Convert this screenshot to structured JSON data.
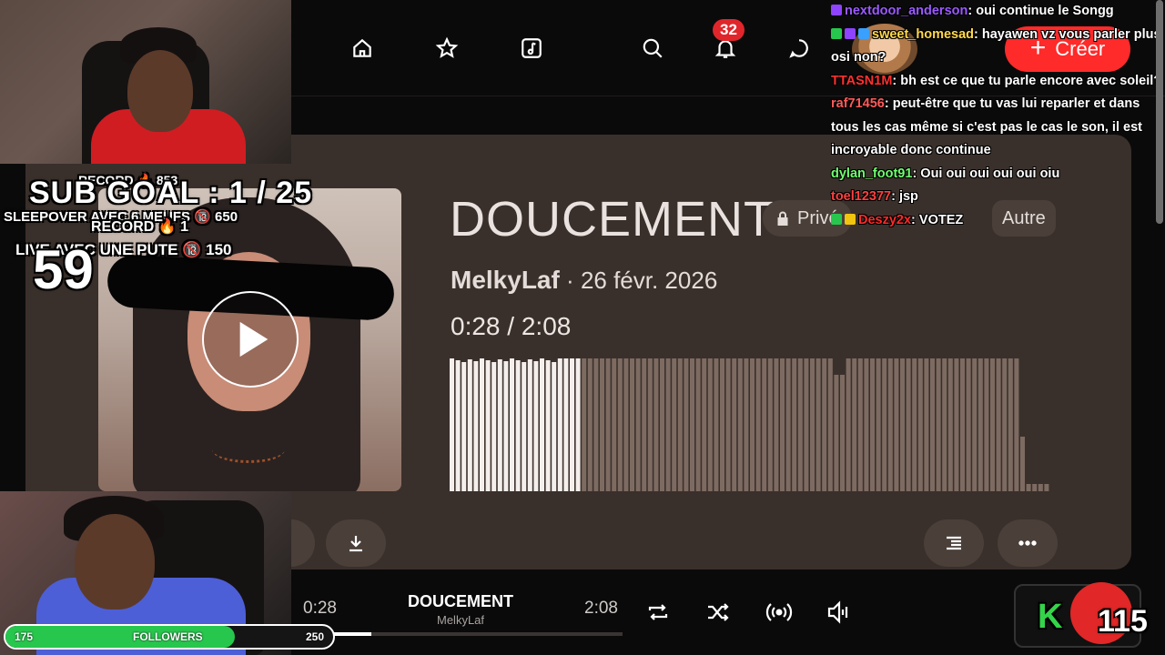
{
  "nav": {
    "notifications_count": "32",
    "create_label": "Créer"
  },
  "track": {
    "title": "DOUCEMENT",
    "privacy": "Privé",
    "other_label": "Autre",
    "artist": "MelkyLaf",
    "date_sep": " · ",
    "date": "26 févr. 2026",
    "time_current": "0:28",
    "time_sep": " / ",
    "time_total": "2:08",
    "progress_fraction": 0.22
  },
  "player": {
    "time_current": "0:28",
    "title": "DOUCEMENT",
    "artist": "MelkyLaf",
    "time_total": "2:08",
    "progress_fraction": 0.22
  },
  "overlay": {
    "subgoal": "SUB GOAL : 1 / 25",
    "record_line": "RECORD 🔥 853",
    "goal_line_1": "LIVE AVEC UNE PUTE 🔞 150",
    "goal_line_2": "SLEEPOVER AVEC 6 MEUFS 🔞 650",
    "record_line_2": "RECORD 🔥 1",
    "counter": "59",
    "followers_label": "FOLLOWERS",
    "followers_current": "175",
    "followers_goal": "250",
    "followers_fraction": 0.7,
    "kick_letter": "K",
    "kick_number": "115"
  },
  "chat": [
    {
      "user": "nextdoor_anderson",
      "color": "#9b59ff",
      "badges": [
        "#8e44ff"
      ],
      "text": "oui continue le Songg"
    },
    {
      "user": "sweet_homesad",
      "color": "#ffd84a",
      "badges": [
        "#27c74d",
        "#8e44ff",
        "#3aa0ff"
      ],
      "text": "hayawen vz vous parler plus osi non?"
    },
    {
      "user": "TTASN1M",
      "color": "#ff3030",
      "badges": [],
      "text": "bh est ce que tu parle encore avec soleil?"
    },
    {
      "user": "raf71456",
      "color": "#ff5a5a",
      "badges": [],
      "text": "peut-être que tu vas lui reparler et dans tous les cas même si c'est pas le cas le son, il est incroyable donc continue"
    },
    {
      "user": "dylan_foot91",
      "color": "#6fff6f",
      "badges": [],
      "text": "Oui oui oui oui oui oiu"
    },
    {
      "user": "toel12377",
      "color": "#ff4040",
      "badges": [],
      "text": "jsp"
    },
    {
      "user": "Deszy2x",
      "color": "#ff2a2a",
      "badges": [
        "#27c74d",
        "#f1c40f"
      ],
      "text": "VOTEZ"
    }
  ]
}
